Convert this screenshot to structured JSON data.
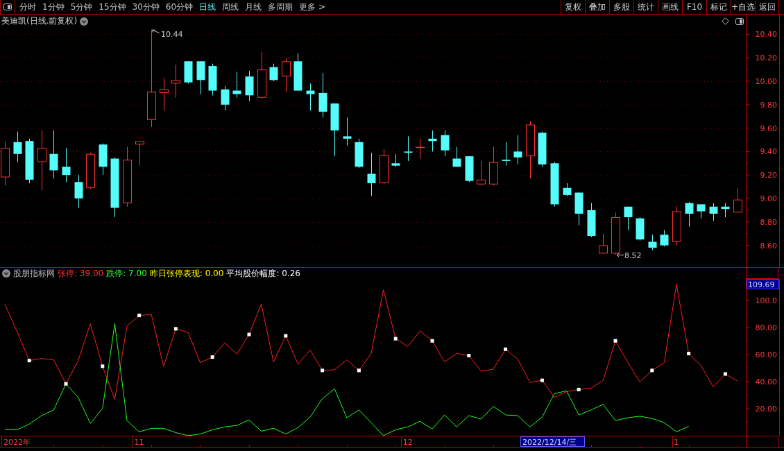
{
  "toolbar": {
    "tabs": [
      {
        "label": "分时",
        "selected": false
      },
      {
        "label": "1分钟",
        "selected": false
      },
      {
        "label": "5分钟",
        "selected": false
      },
      {
        "label": "15分钟",
        "selected": false
      },
      {
        "label": "30分钟",
        "selected": false
      },
      {
        "label": "60分钟",
        "selected": false
      },
      {
        "label": "日线",
        "selected": true
      },
      {
        "label": "周线",
        "selected": false
      },
      {
        "label": "月线",
        "selected": false
      },
      {
        "label": "多周期",
        "selected": false
      },
      {
        "label": "更多 >",
        "selected": false
      }
    ],
    "buttons": [
      "复权",
      "叠加",
      "多股",
      "统计",
      "画线",
      "F10",
      "标记",
      "+自选",
      "返回"
    ]
  },
  "price_chart": {
    "title": "美迪凯(日线.前复权)",
    "high_label": "10.44",
    "low_label": "8.52",
    "chart_data": {
      "type": "candlestick",
      "grid": true,
      "categories": [
        null,
        null,
        null,
        null,
        null,
        null,
        null,
        null,
        null,
        null,
        null,
        null,
        null,
        null,
        null,
        null,
        null,
        null,
        null,
        null,
        null,
        null,
        null,
        null,
        null,
        null,
        null,
        null,
        null,
        null,
        null,
        null,
        null,
        null,
        null,
        null,
        null,
        null,
        null,
        null,
        null,
        null,
        null,
        null,
        null,
        null,
        null,
        null,
        null,
        null,
        null,
        null,
        null,
        null,
        null,
        null,
        null,
        null,
        null,
        null,
        null
      ],
      "ohlc": [
        [
          9.18,
          9.48,
          9.11,
          9.43
        ],
        [
          9.48,
          9.57,
          9.31,
          9.38
        ],
        [
          9.49,
          9.51,
          9.13,
          9.16
        ],
        [
          9.31,
          9.58,
          9.07,
          9.43
        ],
        [
          9.38,
          9.58,
          9.17,
          9.24
        ],
        [
          9.27,
          9.43,
          9.14,
          9.2
        ],
        [
          9.14,
          9.2,
          8.92,
          9.0
        ],
        [
          9.09,
          9.39,
          9.08,
          9.38
        ],
        [
          9.46,
          9.47,
          9.2,
          9.27
        ],
        [
          9.34,
          9.35,
          8.84,
          8.92
        ],
        [
          8.96,
          9.44,
          8.93,
          9.33
        ],
        [
          9.46,
          9.49,
          9.28,
          9.49
        ],
        [
          9.67,
          10.44,
          9.61,
          9.91
        ],
        [
          9.9,
          10.03,
          9.75,
          9.93
        ],
        [
          9.98,
          10.14,
          9.86,
          10.01
        ],
        [
          10.17,
          10.17,
          9.98,
          9.99
        ],
        [
          10.17,
          10.17,
          9.89,
          10.01
        ],
        [
          10.13,
          10.15,
          9.88,
          9.92
        ],
        [
          9.93,
          9.96,
          9.75,
          9.8
        ],
        [
          9.92,
          10.08,
          9.86,
          9.89
        ],
        [
          10.04,
          10.09,
          9.83,
          9.88
        ],
        [
          9.86,
          10.25,
          9.85,
          10.1
        ],
        [
          10.12,
          10.15,
          10.0,
          10.01
        ],
        [
          10.04,
          10.2,
          9.91,
          10.17
        ],
        [
          10.17,
          10.24,
          9.92,
          9.92
        ],
        [
          9.92,
          9.98,
          9.75,
          9.89
        ],
        [
          9.9,
          10.07,
          9.69,
          9.74
        ],
        [
          9.81,
          9.81,
          9.36,
          9.58
        ],
        [
          9.53,
          9.69,
          9.45,
          9.51
        ],
        [
          9.48,
          9.51,
          9.26,
          9.27
        ],
        [
          9.21,
          9.39,
          9.02,
          9.13
        ],
        [
          9.13,
          9.42,
          9.12,
          9.37
        ],
        [
          9.3,
          9.38,
          9.27,
          9.28
        ],
        [
          9.4,
          9.53,
          9.32,
          9.39
        ],
        [
          9.43,
          9.51,
          9.34,
          9.44
        ],
        [
          9.51,
          9.58,
          9.4,
          9.49
        ],
        [
          9.54,
          9.58,
          9.36,
          9.41
        ],
        [
          9.34,
          9.44,
          9.27,
          9.27
        ],
        [
          9.36,
          9.36,
          9.14,
          9.15
        ],
        [
          9.12,
          9.32,
          9.11,
          9.16
        ],
        [
          9.12,
          9.44,
          9.11,
          9.31
        ],
        [
          9.33,
          9.48,
          9.28,
          9.32
        ],
        [
          9.4,
          9.54,
          9.29,
          9.35
        ],
        [
          9.36,
          9.66,
          9.17,
          9.63
        ],
        [
          9.56,
          9.57,
          9.27,
          9.29
        ],
        [
          9.3,
          9.31,
          8.93,
          8.95
        ],
        [
          9.09,
          9.13,
          9.02,
          9.03
        ],
        [
          9.05,
          9.05,
          8.77,
          8.87
        ],
        [
          8.9,
          8.96,
          8.67,
          8.68
        ],
        [
          8.53,
          8.7,
          8.53,
          8.6
        ],
        [
          8.53,
          8.88,
          8.52,
          8.84
        ],
        [
          8.93,
          8.93,
          8.73,
          8.84
        ],
        [
          8.83,
          8.84,
          8.64,
          8.65
        ],
        [
          8.63,
          8.69,
          8.56,
          8.58
        ],
        [
          8.69,
          8.73,
          8.59,
          8.6
        ],
        [
          8.63,
          8.93,
          8.6,
          8.89
        ],
        [
          8.96,
          8.97,
          8.76,
          8.87
        ],
        [
          8.95,
          8.95,
          8.83,
          8.89
        ],
        [
          8.93,
          8.96,
          8.81,
          8.87
        ],
        [
          8.93,
          8.96,
          8.84,
          8.91
        ],
        [
          8.88,
          9.09,
          8.88,
          8.99
        ]
      ],
      "ylim": [
        8.414,
        10.456
      ],
      "yticks": [
        {
          "value": 10.4,
          "label": "10.40"
        },
        {
          "value": 10.2,
          "label": "10.20"
        },
        {
          "value": 10.0,
          "label": "10.00"
        },
        {
          "value": 9.8,
          "label": "9.80"
        },
        {
          "value": 9.6,
          "label": "9.60"
        },
        {
          "value": 9.4,
          "label": "9.40"
        },
        {
          "value": 9.2,
          "label": "9.20"
        },
        {
          "value": 9.0,
          "label": "9.00"
        },
        {
          "value": 8.8,
          "label": "8.80"
        },
        {
          "value": 8.6,
          "label": "8.60"
        }
      ]
    }
  },
  "indicator": {
    "name": "股朋指标网",
    "stats": [
      {
        "text": "张停: 39.00",
        "color": "#ff3232"
      },
      {
        "text": "跌停: 7.00",
        "color": "#32ff32"
      },
      {
        "text": "昨日张停表现: 0.00",
        "color": "#ffff00"
      },
      {
        "text": "平均股价幅度: 0.26",
        "color": "#ffffff"
      }
    ],
    "axis_top_value": "109.69",
    "chart_data": {
      "type": "line",
      "categories": [
        null,
        "2022年",
        null,
        null,
        null,
        null,
        null,
        null,
        null,
        null,
        null,
        "11",
        null,
        null,
        null,
        null,
        null,
        null,
        null,
        null,
        null,
        null,
        null,
        null,
        null,
        null,
        null,
        null,
        null,
        null,
        null,
        null,
        null,
        "12",
        null,
        null,
        null,
        null,
        null,
        null,
        null,
        null,
        null,
        null,
        null,
        null,
        null,
        null,
        null,
        null,
        null,
        null,
        null,
        null,
        null,
        "1",
        null,
        null,
        null,
        null,
        null
      ],
      "ylim": [
        0,
        116
      ],
      "yticks": [
        {
          "value": 100,
          "label": "100.0"
        },
        {
          "value": 80,
          "label": "80.00"
        },
        {
          "value": 60,
          "label": "60.00"
        },
        {
          "value": 40,
          "label": "40.00"
        },
        {
          "value": 20,
          "label": "20.00"
        }
      ],
      "series": [
        {
          "color": "#ff1e1e",
          "values": [
            97.4,
            77.0,
            55.6,
            57.2,
            56.1,
            38.4,
            55.6,
            82.8,
            51.4,
            26.9,
            81.2,
            89.0,
            89.6,
            51.4,
            79.1,
            76.5,
            54.0,
            58.2,
            68.7,
            60.3,
            74.9,
            97.4,
            54.6,
            73.9,
            53.0,
            63.4,
            48.3,
            48.8,
            56.1,
            48.3,
            60.8,
            108.0,
            71.8,
            66.1,
            77.5,
            70.2,
            54.6,
            60.8,
            59.3,
            47.8,
            49.3,
            64.0,
            56.7,
            39.4,
            41.0,
            28.5,
            32.6,
            34.2,
            35.2,
            41.0,
            70.2,
            54.6,
            39.9,
            48.3,
            54.0,
            112.0,
            60.8,
            52.0,
            36.3,
            45.7,
            40.5
          ]
        },
        {
          "color": "#1eff1e",
          "values": [
            4.4,
            4.4,
            8.6,
            14.9,
            19.1,
            38.4,
            28.5,
            9.1,
            20.1,
            82.8,
            11.2,
            2.9,
            5.5,
            5.5,
            2.3,
            0,
            1.3,
            4.4,
            6.5,
            7.6,
            11.7,
            3.4,
            5.5,
            1.3,
            6.0,
            13.8,
            27.4,
            34.7,
            13.3,
            19.1,
            9.7,
            0,
            4.4,
            6.5,
            10.7,
            5.0,
            15.4,
            6.5,
            14.9,
            12.3,
            21.7,
            15.4,
            14.9,
            6.5,
            13.8,
            31.1,
            33.2,
            15.4,
            19.1,
            23.2,
            11.2,
            13.3,
            14.4,
            12.8,
            9.7,
            2.9,
            7.0,
            null,
            null,
            null,
            null
          ]
        },
        {
          "type": "scatter",
          "color": "#ffffff",
          "values": [
            null,
            null,
            55.6,
            null,
            null,
            38.4,
            null,
            null,
            51.4,
            null,
            null,
            89.0,
            null,
            null,
            79.1,
            null,
            null,
            58.2,
            null,
            null,
            74.9,
            null,
            null,
            73.9,
            null,
            null,
            48.3,
            null,
            null,
            48.3,
            null,
            null,
            71.8,
            null,
            null,
            70.2,
            null,
            null,
            59.3,
            null,
            null,
            64.0,
            null,
            null,
            41.0,
            null,
            null,
            34.2,
            null,
            null,
            70.2,
            null,
            null,
            48.3,
            null,
            null,
            60.8,
            null,
            null,
            45.7,
            null
          ]
        }
      ]
    }
  },
  "time_axis": {
    "cursor_date": "2022/12/14/三"
  }
}
